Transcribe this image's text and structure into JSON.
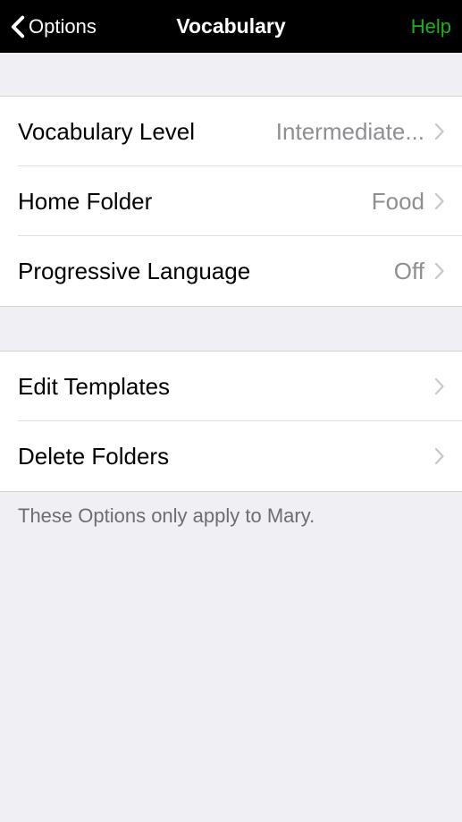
{
  "navbar": {
    "backLabel": "Options",
    "title": "Vocabulary",
    "helpLabel": "Help"
  },
  "section1": {
    "rows": [
      {
        "label": "Vocabulary Level",
        "value": "Intermediate..."
      },
      {
        "label": "Home Folder",
        "value": "Food"
      },
      {
        "label": "Progressive Language",
        "value": "Off"
      }
    ]
  },
  "section2": {
    "rows": [
      {
        "label": "Edit Templates"
      },
      {
        "label": "Delete Folders"
      }
    ]
  },
  "footerNote": "These Options only apply to Mary."
}
